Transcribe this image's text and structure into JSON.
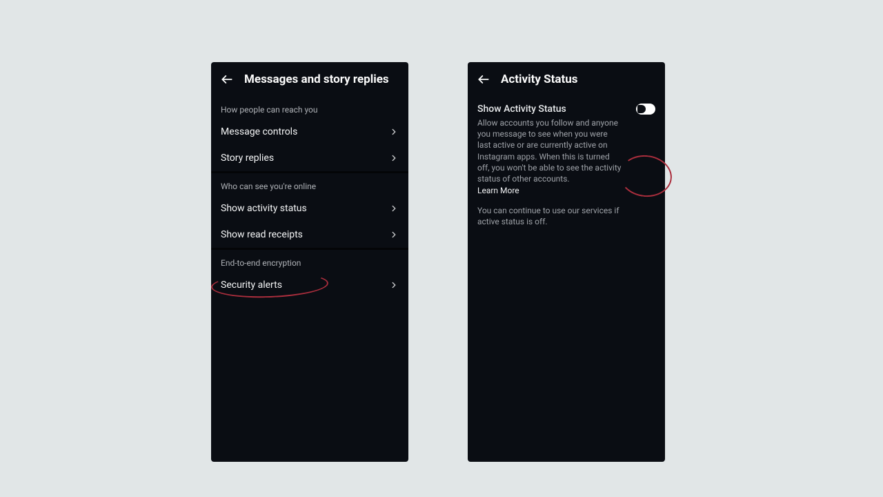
{
  "left": {
    "title": "Messages and story replies",
    "sections": [
      {
        "heading": "How people can reach you",
        "items": [
          {
            "label": "Message controls"
          },
          {
            "label": "Story replies"
          }
        ]
      },
      {
        "heading": "Who can see you're online",
        "items": [
          {
            "label": "Show activity status"
          },
          {
            "label": "Show read receipts"
          }
        ]
      },
      {
        "heading": "End-to-end encryption",
        "items": [
          {
            "label": "Security alerts"
          }
        ]
      }
    ]
  },
  "right": {
    "title": "Activity Status",
    "toggle_label": "Show Activity Status",
    "description": "Allow accounts you follow and anyone you message to see when you were last active or are currently active on Instagram apps. When this is turned off, you won't be able to see the activity status of other accounts.",
    "learn_more": "Learn More",
    "note": "You can continue to use our services if active status is off."
  }
}
